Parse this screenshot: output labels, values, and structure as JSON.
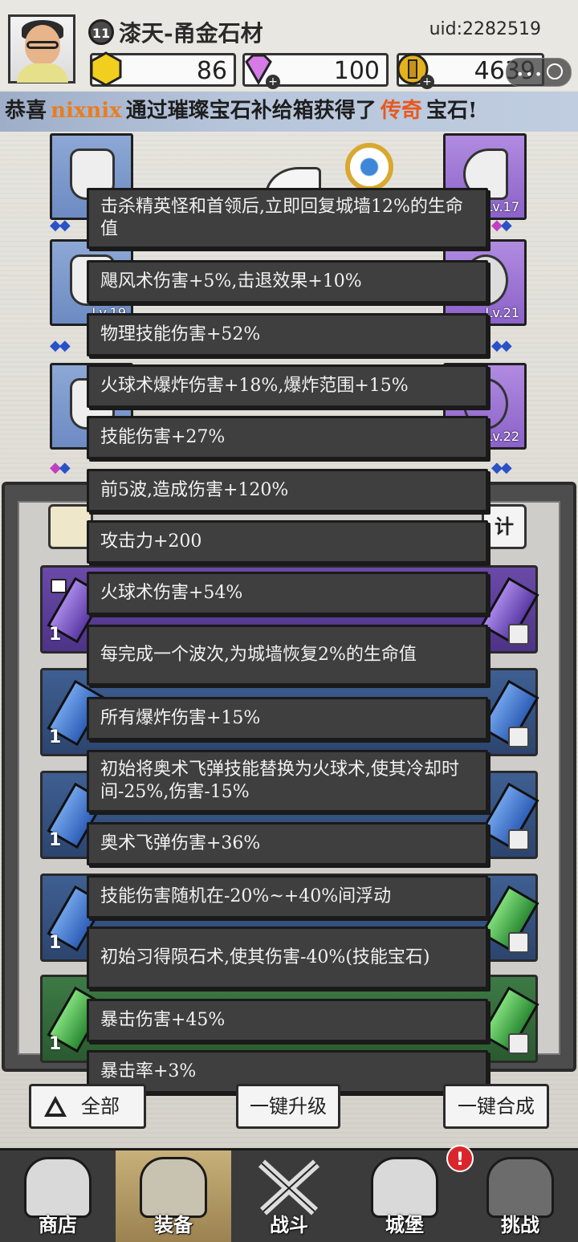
{
  "header": {
    "level": "11",
    "player_name": "漆天-甬金石材",
    "uid": "uid:2282519",
    "resources": [
      {
        "name": "gold-hexagon",
        "value": "86"
      },
      {
        "name": "diamond",
        "value": "100"
      },
      {
        "name": "coin",
        "value": "4639"
      }
    ]
  },
  "banner": {
    "prefix": "恭喜",
    "user": "nixnix",
    "middle": "通过璀璨宝石补给箱获得了",
    "grade": "传奇",
    "suffix": "宝石!"
  },
  "equipment": {
    "levels": [
      "Lv.17",
      "Lv.19",
      "Lv.21",
      "Lv.22"
    ]
  },
  "inventory": {
    "side_label": "计",
    "cards": [
      {
        "color": "purple",
        "count": "1"
      },
      {
        "color": "blue",
        "count": "1"
      },
      {
        "color": "blue",
        "count": "1"
      },
      {
        "color": "blue",
        "count": "1"
      },
      {
        "color": "green",
        "count": "1"
      }
    ]
  },
  "popup": {
    "items": [
      "击杀精英怪和首领后,立即回复城墙12%的生命值",
      "飓风术伤害+5%,击退效果+10%",
      "物理技能伤害+52%",
      "火球术爆炸伤害+18%,爆炸范围+15%",
      "技能伤害+27%",
      "前5波,造成伤害+120%",
      "攻击力+200",
      "火球术伤害+54%",
      "每完成一个波次,为城墙恢复2%的生命值",
      "所有爆炸伤害+15%",
      "初始将奥术飞弹技能替换为火球术,使其冷却时间-25%,伤害-15%",
      "奥术飞弹伤害+36%",
      "技能伤害随机在-20%~+40%间浮动",
      "初始习得陨石术,使其伤害-40%(技能宝石)",
      "暴击伤害+45%",
      "暴击率+3%"
    ]
  },
  "actions": {
    "all": "全部",
    "upgrade": "一键升级",
    "merge": "一键合成"
  },
  "nav": {
    "items": [
      "商店",
      "装备",
      "战斗",
      "城堡",
      "挑战"
    ],
    "active": "装备",
    "notice": "!"
  }
}
